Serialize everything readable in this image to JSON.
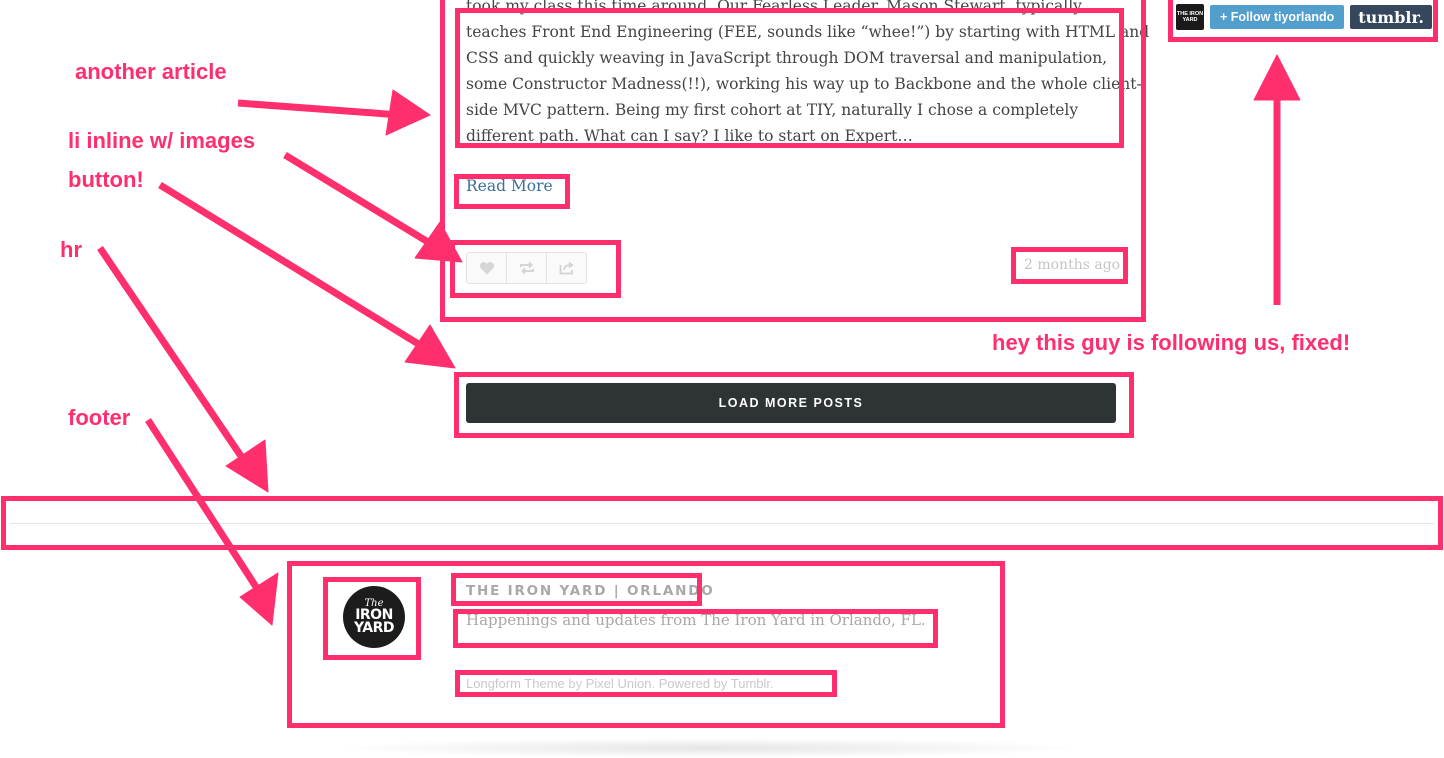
{
  "article": {
    "lines": [
      "took my class this time around. Our Fearless Leader, Mason Stewart, typically",
      "teaches Front End Engineering (FEE, sounds like “whee!”) by starting with HTML and",
      "CSS and quickly weaving in JavaScript through DOM traversal and manipulation,",
      "some Constructor Madness(!!), working his way up to Backbone and the whole client-",
      "side MVC pattern. Being my first cohort at TIY, naturally I chose a completely",
      "different path. What can I say? I like to start on Expert…"
    ],
    "read_more": "Read More",
    "actions": [
      "heart-icon",
      "reblog-icon",
      "share-icon"
    ],
    "timestamp": "2 months ago"
  },
  "load_more": "LOAD MORE POSTS",
  "tumblr_bar": {
    "avatar_text": "THE IRON YARD",
    "follow_label": "+ Follow tiyorlando",
    "logo_text": "tumblr."
  },
  "footer": {
    "logo": {
      "the": "The",
      "line1": "IRON",
      "line2": "YARD"
    },
    "title": "THE IRON YARD | ORLANDO",
    "description": "Happenings and updates from The Iron Yard in Orlando, FL.",
    "credits": {
      "theme_link": "Longform Theme",
      "by_text": " by ",
      "author_link": "Pixel Union",
      "sep": ". ",
      "powered_link": "Powered by Tumblr",
      "end": "."
    }
  },
  "annotations": {
    "another_article": "another article",
    "li_inline": "li inline w/ images",
    "button": "button!",
    "hr": "hr",
    "footer": "footer",
    "following": "hey this guy is following us, fixed!"
  },
  "colors": {
    "annotation": "#ff2f6e",
    "load_more_bg": "#2e3336",
    "follow_bg": "#529ecc",
    "tumblr_bg": "#36465d",
    "link": "#3a6f9a"
  }
}
